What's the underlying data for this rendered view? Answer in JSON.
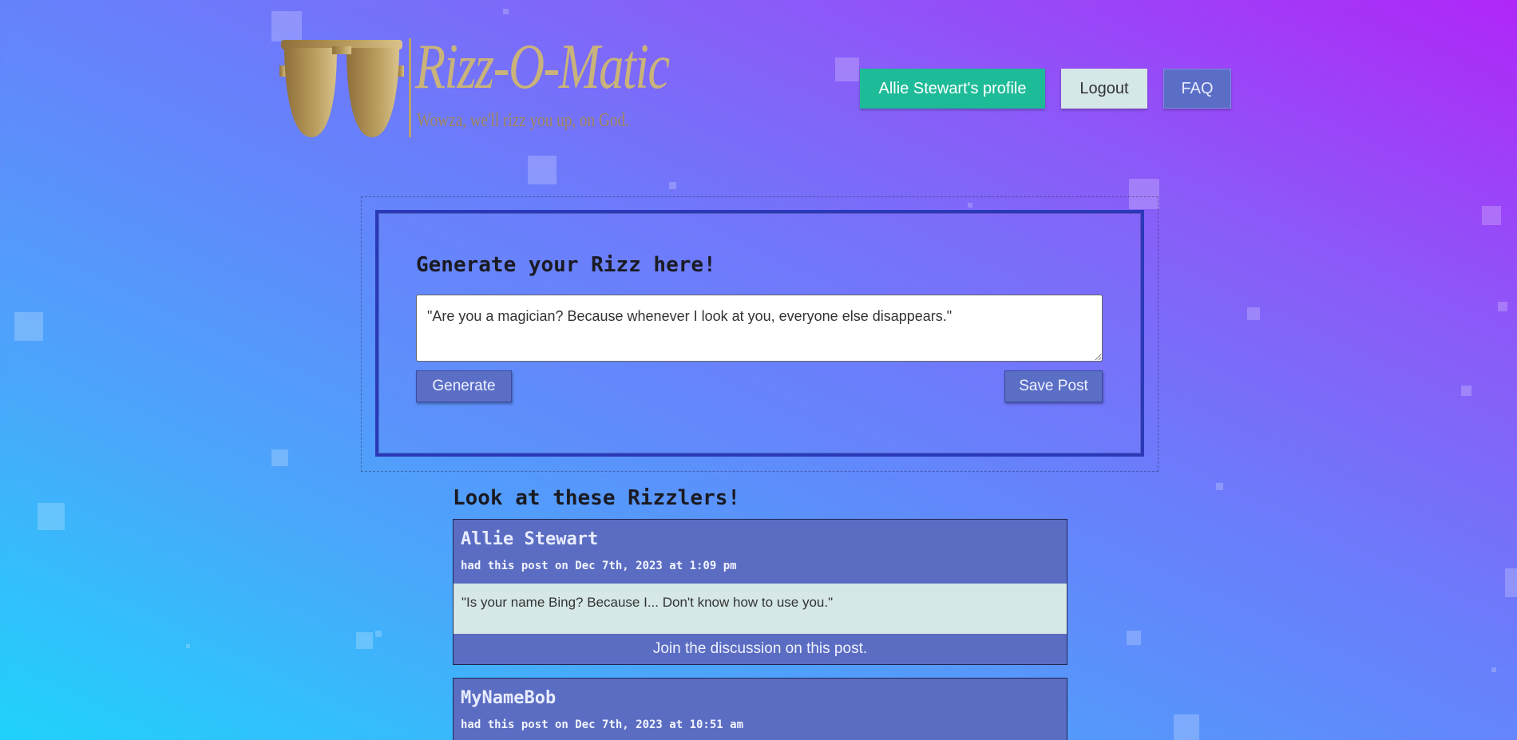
{
  "header": {
    "logo_title": "Rizz-O-Matic",
    "logo_tagline": "Wowza, we'll rizz you up, on God.",
    "logo_icon": "sunglasses-icon",
    "nav": {
      "profile_label": "Allie Stewart's profile",
      "logout_label": "Logout",
      "faq_label": "FAQ"
    }
  },
  "generator": {
    "title": "Generate your Rizz here!",
    "textarea_value": "\"Are you a magician? Because whenever I look at you, everyone else disappears.\"",
    "generate_label": "Generate",
    "save_label": "Save Post"
  },
  "feed": {
    "title": "Look at these Rizzlers!",
    "posts": [
      {
        "author": "Allie Stewart",
        "meta": "had this post on Dec 7th, 2023 at 1:09 pm",
        "body": "\"Is your name Bing? Because I... Don't know how to use you.\"",
        "discuss_label": "Join the discussion on this post."
      },
      {
        "author": "MyNameBob",
        "meta": "had this post on Dec 7th, 2023 at 10:51 am"
      }
    ]
  },
  "colors": {
    "profile_button": "#1ebb98",
    "logout_button": "#d5e7e7",
    "primary_button": "#5b6ec6",
    "post_body": "#d5e7e7",
    "gold_logo": "#c9b37a"
  }
}
